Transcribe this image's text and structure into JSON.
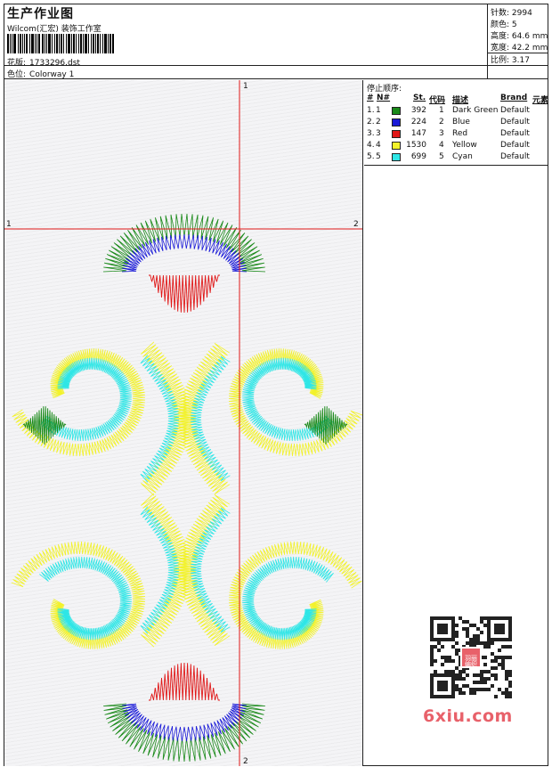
{
  "header": {
    "title": "生产作业图",
    "company": "Wilcom(汇宏) 装饰工作室",
    "design_label": "花版:",
    "design_value": "1733296.dst",
    "colorway_label": "色位:",
    "colorway_value": "Colorway 1"
  },
  "stats": [
    {
      "label": "针数:",
      "value": "2994"
    },
    {
      "label": "颜色:",
      "value": "5"
    },
    {
      "label": "高度:",
      "value": "64.6 mm"
    },
    {
      "label": "宽度:",
      "value": "42.2 mm"
    },
    {
      "label": "比例:",
      "value": "3.17"
    }
  ],
  "guides": {
    "top_label": "1",
    "bottom_label": "2",
    "left_label": "1",
    "right_label": "2"
  },
  "stop_sequence": {
    "title": "停止顺序:",
    "columns": [
      "#",
      "N#",
      "St.",
      "代码",
      "描述",
      "Brand",
      "元素"
    ],
    "rows": [
      {
        "idx": "1.",
        "n": "1",
        "color": "#1a8a1a",
        "st": "392",
        "code": "1",
        "desc": "Dark Green",
        "brand": "Default"
      },
      {
        "idx": "2.",
        "n": "2",
        "color": "#1a1ad8",
        "st": "224",
        "code": "2",
        "desc": "Blue",
        "brand": "Default"
      },
      {
        "idx": "3.",
        "n": "3",
        "color": "#e01818",
        "st": "147",
        "code": "3",
        "desc": "Red",
        "brand": "Default"
      },
      {
        "idx": "4.",
        "n": "4",
        "color": "#f2f22a",
        "st": "1530",
        "code": "4",
        "desc": "Yellow",
        "brand": "Default"
      },
      {
        "idx": "5.",
        "n": "5",
        "color": "#2ee6e6",
        "st": "699",
        "code": "5",
        "desc": "Cyan",
        "brand": "Default"
      }
    ]
  },
  "watermark": "6xiu.com",
  "qr_logo": "羽丽编织",
  "colors": {
    "dark_green": "#1a8a1a",
    "blue": "#1a1ad8",
    "red": "#e01818",
    "yellow": "#f2f22a",
    "cyan": "#2ee6e6",
    "guide": "#e01818"
  }
}
